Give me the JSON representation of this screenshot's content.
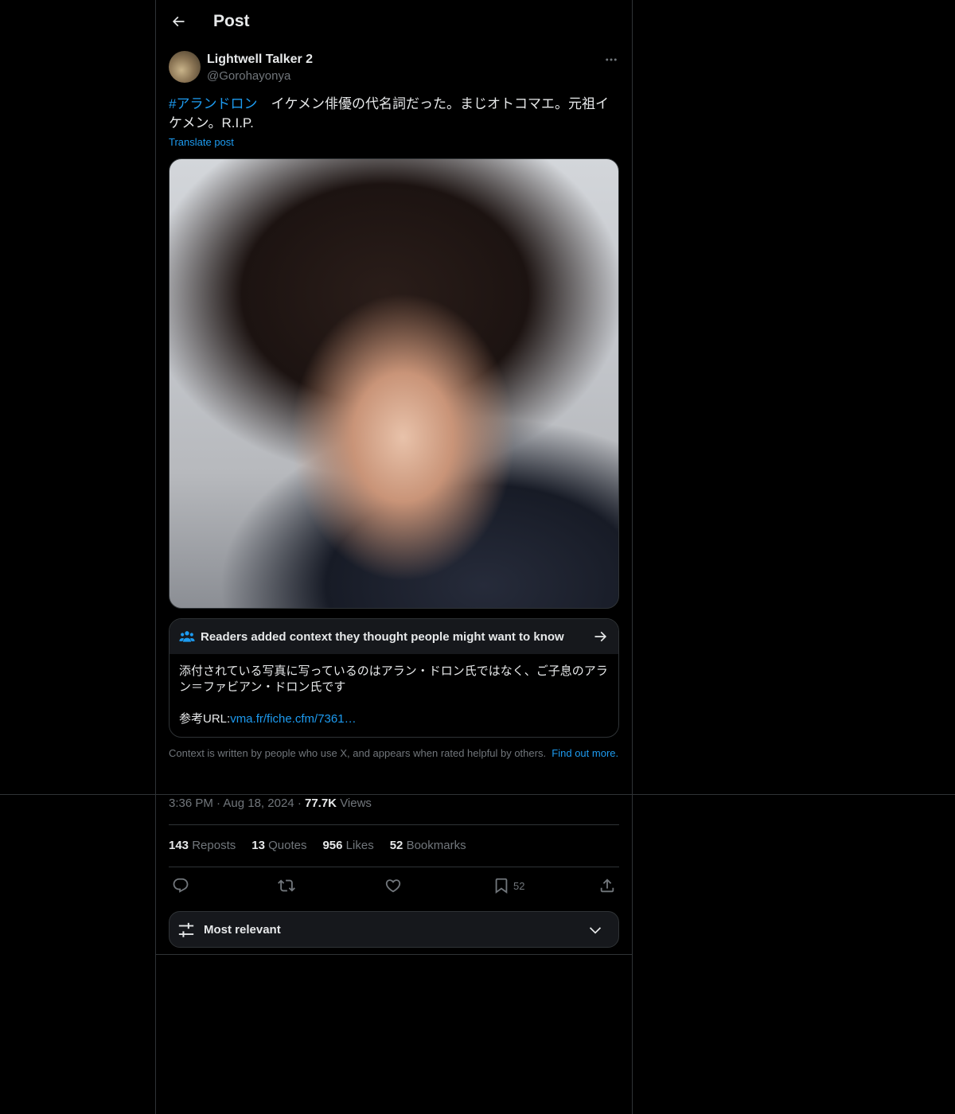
{
  "header": {
    "title": "Post"
  },
  "author": {
    "name": "Lightwell Talker 2",
    "handle": "@Gorohayonya"
  },
  "post": {
    "hashtag": "#アランドロン",
    "text": "　イケメン俳優の代名詞だった。まじオトコマエ。元祖イケメン。R.I.P.",
    "translate_label": "Translate post"
  },
  "note": {
    "title": "Readers added context they thought people might want to know",
    "body": "添付されている写真に写っているのはアラン・ドロン氏ではなく、ご子息のアラン＝ファビアン・ドロン氏です",
    "ref_label": "参考URL:",
    "ref_link": "vma.fr/fiche.cfm/7361…",
    "context_text": "Context is written by people who use X, and appears when rated helpful by others.",
    "context_link": "Find out more."
  },
  "meta": {
    "time": "3:36 PM",
    "date": "Aug 18, 2024",
    "views_count": "77.7K",
    "views_label": "Views",
    "separator": "·"
  },
  "stats": {
    "reposts_count": "143",
    "reposts_label": "Reposts",
    "quotes_count": "13",
    "quotes_label": "Quotes",
    "likes_count": "956",
    "likes_label": "Likes",
    "bookmarks_count": "52",
    "bookmarks_label": "Bookmarks"
  },
  "actions": {
    "reply_icon": "reply-icon",
    "repost_icon": "repost-icon",
    "like_icon": "heart-icon",
    "bookmark_icon": "bookmark-icon",
    "bookmark_count": "52",
    "share_icon": "share-icon"
  },
  "sort": {
    "label": "Most relevant"
  },
  "colors": {
    "background": "#000000",
    "accent": "#1d9bf0",
    "text_primary": "#e7e9ea",
    "text_secondary": "#71767b",
    "border": "#2f3336",
    "note_header_bg": "#16181c"
  }
}
